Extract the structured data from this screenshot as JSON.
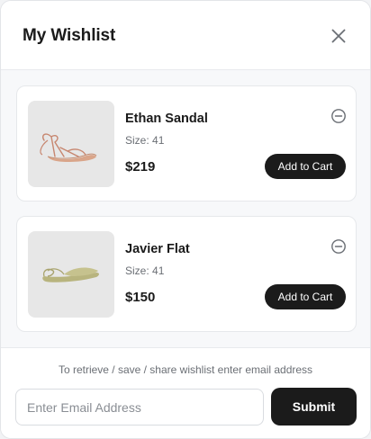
{
  "header": {
    "title": "My Wishlist",
    "close_icon": "close-icon"
  },
  "items": [
    {
      "name": "Ethan Sandal",
      "size_label": "Size:",
      "size": "41",
      "price": "$219",
      "cart_label": "Add to Cart",
      "remove_icon": "minus-circle-icon"
    },
    {
      "name": "Javier Flat",
      "size_label": "Size:",
      "size": "41",
      "price": "$150",
      "cart_label": "Add to Cart",
      "remove_icon": "minus-circle-icon"
    }
  ],
  "footer": {
    "hint": "To retrieve / save / share wishlist enter email address",
    "email_placeholder": "Enter Email Address",
    "email_value": "",
    "submit_label": "Submit"
  },
  "colors": {
    "button": "#1b1b1b",
    "background": "#f7f8fa",
    "thumb_bg": "#e7e7e7"
  }
}
